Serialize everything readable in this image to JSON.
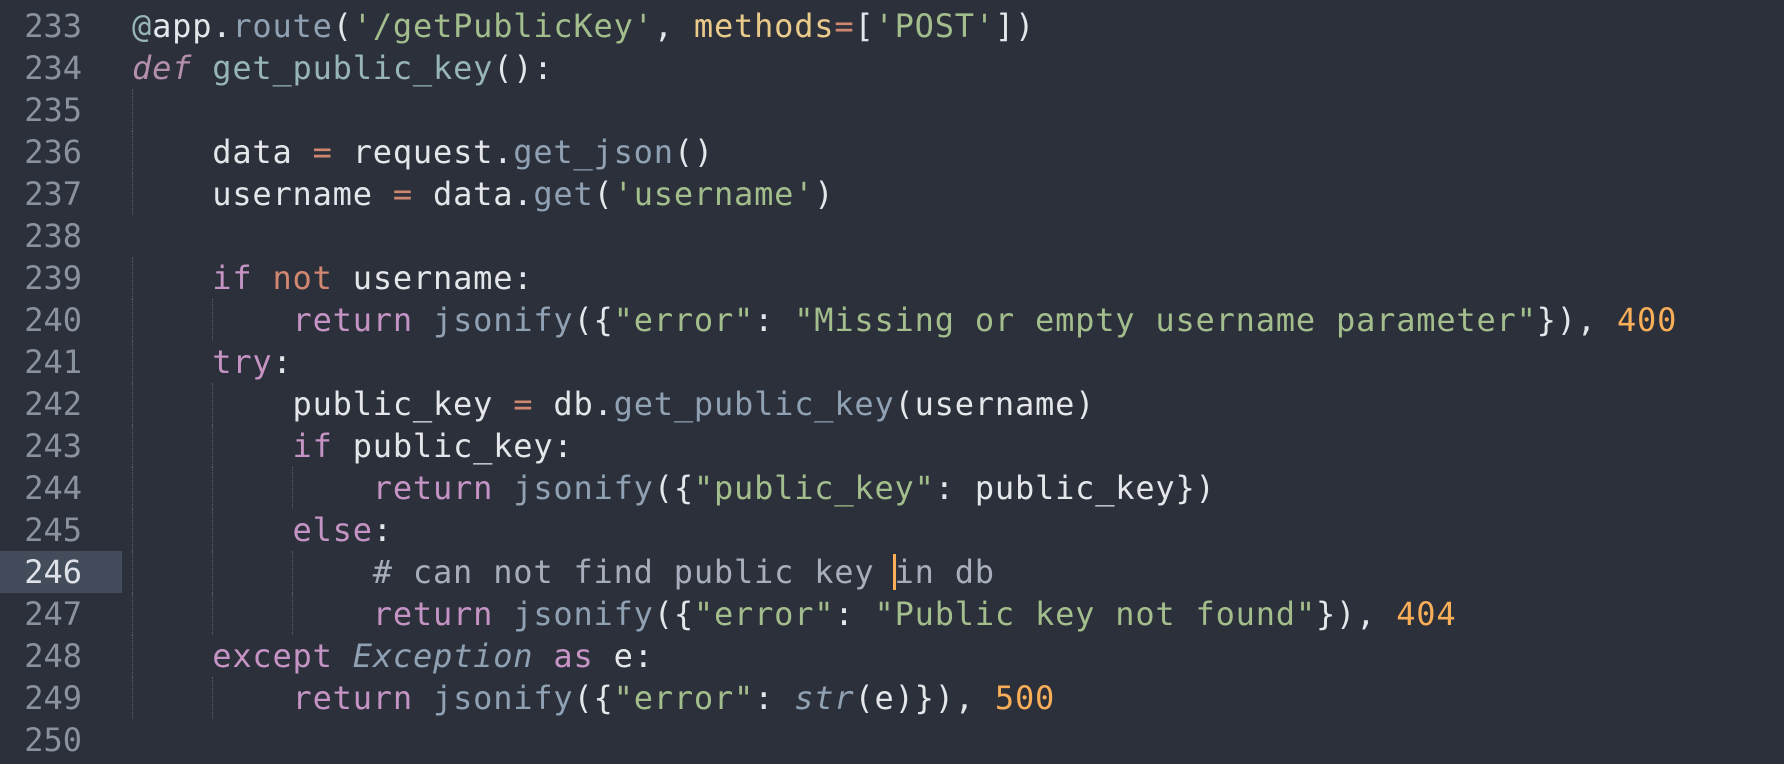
{
  "editor": {
    "theme_colors": {
      "background": "#2b303b",
      "current_line_gutter": "#434c5a",
      "cursor": "#f9ae58"
    },
    "current_line": 246,
    "lines": [
      {
        "number": "233",
        "indent": 0,
        "tokens": [
          {
            "t": "@",
            "c": "deco"
          },
          {
            "t": "app",
            "c": "plain"
          },
          {
            "t": ".",
            "c": "plain"
          },
          {
            "t": "route",
            "c": "fn"
          },
          {
            "t": "(",
            "c": "plain"
          },
          {
            "t": "'/getPublicKey'",
            "c": "str"
          },
          {
            "t": ", ",
            "c": "plain"
          },
          {
            "t": "methods",
            "c": "param"
          },
          {
            "t": "=",
            "c": "op"
          },
          {
            "t": "[",
            "c": "plain"
          },
          {
            "t": "'POST'",
            "c": "str"
          },
          {
            "t": "])",
            "c": "plain"
          }
        ]
      },
      {
        "number": "234",
        "indent": 0,
        "tokens": [
          {
            "t": "def",
            "c": "kwi"
          },
          {
            "t": " ",
            "c": "plain"
          },
          {
            "t": "get_public_key",
            "c": "def"
          },
          {
            "t": "():",
            "c": "plain"
          }
        ]
      },
      {
        "number": "235",
        "indent": 0,
        "tokens": []
      },
      {
        "number": "236",
        "indent": 1,
        "tokens": [
          {
            "t": "data ",
            "c": "plain"
          },
          {
            "t": "=",
            "c": "op"
          },
          {
            "t": " request",
            "c": "plain"
          },
          {
            "t": ".",
            "c": "plain"
          },
          {
            "t": "get_json",
            "c": "call"
          },
          {
            "t": "()",
            "c": "plain"
          }
        ]
      },
      {
        "number": "237",
        "indent": 1,
        "tokens": [
          {
            "t": "username ",
            "c": "plain"
          },
          {
            "t": "=",
            "c": "op"
          },
          {
            "t": " data",
            "c": "plain"
          },
          {
            "t": ".",
            "c": "plain"
          },
          {
            "t": "get",
            "c": "call"
          },
          {
            "t": "(",
            "c": "plain"
          },
          {
            "t": "'username'",
            "c": "str"
          },
          {
            "t": ")",
            "c": "plain"
          }
        ]
      },
      {
        "number": "238",
        "indent": 0,
        "tokens": []
      },
      {
        "number": "239",
        "indent": 1,
        "tokens": [
          {
            "t": "if",
            "c": "kw"
          },
          {
            "t": " ",
            "c": "plain"
          },
          {
            "t": "not",
            "c": "op"
          },
          {
            "t": " username:",
            "c": "plain"
          }
        ]
      },
      {
        "number": "240",
        "indent": 2,
        "tokens": [
          {
            "t": "return",
            "c": "kw"
          },
          {
            "t": " ",
            "c": "plain"
          },
          {
            "t": "jsonify",
            "c": "call"
          },
          {
            "t": "({",
            "c": "plain"
          },
          {
            "t": "\"error\"",
            "c": "str"
          },
          {
            "t": ": ",
            "c": "plain"
          },
          {
            "t": "\"Missing or empty username parameter\"",
            "c": "str"
          },
          {
            "t": "}), ",
            "c": "plain"
          },
          {
            "t": "400",
            "c": "num"
          }
        ]
      },
      {
        "number": "241",
        "indent": 1,
        "tokens": [
          {
            "t": "try",
            "c": "kw"
          },
          {
            "t": ":",
            "c": "plain"
          }
        ]
      },
      {
        "number": "242",
        "indent": 2,
        "tokens": [
          {
            "t": "public_key ",
            "c": "plain"
          },
          {
            "t": "=",
            "c": "op"
          },
          {
            "t": " db",
            "c": "plain"
          },
          {
            "t": ".",
            "c": "plain"
          },
          {
            "t": "get_public_key",
            "c": "call"
          },
          {
            "t": "(username)",
            "c": "plain"
          }
        ]
      },
      {
        "number": "243",
        "indent": 2,
        "tokens": [
          {
            "t": "if",
            "c": "kw"
          },
          {
            "t": " public_key:",
            "c": "plain"
          }
        ]
      },
      {
        "number": "244",
        "indent": 3,
        "tokens": [
          {
            "t": "return",
            "c": "kw"
          },
          {
            "t": " ",
            "c": "plain"
          },
          {
            "t": "jsonify",
            "c": "call"
          },
          {
            "t": "({",
            "c": "plain"
          },
          {
            "t": "\"public_key\"",
            "c": "str"
          },
          {
            "t": ": public_key})",
            "c": "plain"
          }
        ]
      },
      {
        "number": "245",
        "indent": 2,
        "tokens": [
          {
            "t": "else",
            "c": "kw"
          },
          {
            "t": ":",
            "c": "plain"
          }
        ]
      },
      {
        "number": "246",
        "indent": 3,
        "tokens": [
          {
            "t": "# can not find public key ",
            "c": "cmt"
          },
          {
            "cursor": true
          },
          {
            "t": "in db",
            "c": "cmt"
          }
        ]
      },
      {
        "number": "247",
        "indent": 3,
        "tokens": [
          {
            "t": "return",
            "c": "kw"
          },
          {
            "t": " ",
            "c": "plain"
          },
          {
            "t": "jsonify",
            "c": "call"
          },
          {
            "t": "({",
            "c": "plain"
          },
          {
            "t": "\"error\"",
            "c": "str"
          },
          {
            "t": ": ",
            "c": "plain"
          },
          {
            "t": "\"Public key not found\"",
            "c": "str"
          },
          {
            "t": "}), ",
            "c": "plain"
          },
          {
            "t": "404",
            "c": "num"
          }
        ]
      },
      {
        "number": "248",
        "indent": 1,
        "tokens": [
          {
            "t": "except",
            "c": "kw"
          },
          {
            "t": " ",
            "c": "plain"
          },
          {
            "t": "Exception",
            "c": "cls"
          },
          {
            "t": " ",
            "c": "plain"
          },
          {
            "t": "as",
            "c": "kw"
          },
          {
            "t": " e:",
            "c": "plain"
          }
        ]
      },
      {
        "number": "249",
        "indent": 2,
        "tokens": [
          {
            "t": "return",
            "c": "kw"
          },
          {
            "t": " ",
            "c": "plain"
          },
          {
            "t": "jsonify",
            "c": "call"
          },
          {
            "t": "({",
            "c": "plain"
          },
          {
            "t": "\"error\"",
            "c": "str"
          },
          {
            "t": ": ",
            "c": "plain"
          },
          {
            "t": "str",
            "c": "cls"
          },
          {
            "t": "(e)}), ",
            "c": "plain"
          },
          {
            "t": "500",
            "c": "num"
          }
        ]
      },
      {
        "number": "250",
        "indent": 0,
        "tokens": []
      }
    ]
  }
}
